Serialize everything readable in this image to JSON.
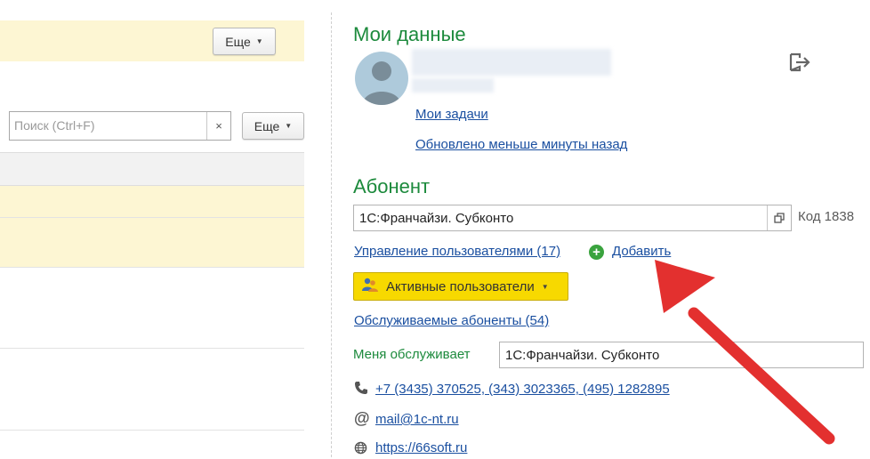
{
  "left": {
    "more_top_label": "Еще",
    "search_placeholder": "Поиск (Ctrl+F)",
    "search_clear": "×",
    "more_search_label": "Еще"
  },
  "my_data": {
    "title": "Мои данные",
    "my_tasks": "Мои задачи",
    "updated": "Обновлено меньше минуты назад"
  },
  "subscriber": {
    "title": "Абонент",
    "name_value": "1С:Франчайзи. Субконто",
    "code_label": "Код 1838",
    "manage_users": "Управление пользователями (17)",
    "add_label": "Добавить",
    "active_users_button": "Активные пользователи",
    "served_subscribers": "Обслуживаемые абоненты (54)",
    "served_by_label": "Меня обслуживает",
    "served_by_value": "1С:Франчайзи. Субконто",
    "phones": "+7 (3435) 370525, (343) 3023365, (495) 1282895",
    "email": "mail@1c-nt.ru",
    "website": "https://66soft.ru"
  },
  "colors": {
    "accent_green": "#1c8a3c",
    "link_blue": "#1a4fa0",
    "highlight_yellow": "#f7d900",
    "annotation_red": "#e3302f"
  },
  "icons": {
    "logout": "logout-icon",
    "open_form": "open-form-icon",
    "add": "plus-circle-icon",
    "users": "users-icon",
    "phone": "phone-icon",
    "email": "at-icon",
    "web": "globe-icon"
  }
}
